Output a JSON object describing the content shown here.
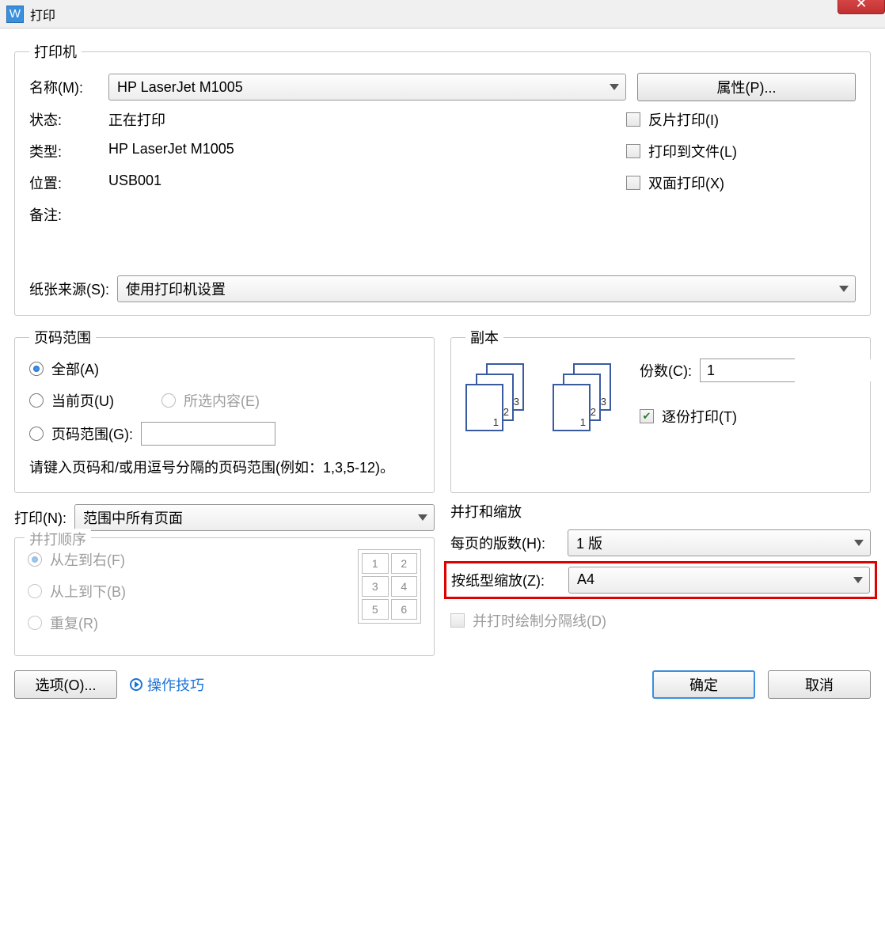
{
  "title": "打印",
  "printer": {
    "group_title": "打印机",
    "name_label": "名称(M):",
    "name_value": "HP LaserJet M1005",
    "properties_button": "属性(P)...",
    "status_label": "状态:",
    "status_value": "正在打印",
    "type_label": "类型:",
    "type_value": "HP LaserJet M1005",
    "location_label": "位置:",
    "location_value": "USB001",
    "remark_label": "备注:",
    "remark_value": "",
    "invert_label": "反片打印(I)",
    "to_file_label": "打印到文件(L)",
    "duplex_label": "双面打印(X)",
    "paper_source_label": "纸张来源(S):",
    "paper_source_value": "使用打印机设置"
  },
  "range": {
    "group_title": "页码范围",
    "all_label": "全部(A)",
    "current_label": "当前页(U)",
    "selection_label": "所选内容(E)",
    "range_label": "页码范围(G):",
    "hint": "请键入页码和/或用逗号分隔的页码范围(例如：1,3,5-12)。"
  },
  "copies": {
    "group_title": "副本",
    "count_label": "份数(C):",
    "count_value": "1",
    "collate_label": "逐份打印(T)",
    "sheet1": "1",
    "sheet2": "2",
    "sheet3": "3"
  },
  "print_what": {
    "label": "打印(N):",
    "value": "范围中所有页面"
  },
  "order": {
    "group_title": "并打顺序",
    "ltr_label": "从左到右(F)",
    "ttb_label": "从上到下(B)",
    "repeat_label": "重复(R)",
    "c1": "1",
    "c2": "2",
    "c3": "3",
    "c4": "4",
    "c5": "5",
    "c6": "6"
  },
  "layout": {
    "group_title": "并打和缩放",
    "per_page_label": "每页的版数(H):",
    "per_page_value": "1 版",
    "scale_label": "按纸型缩放(Z):",
    "scale_value": "A4",
    "divider_label": "并打时绘制分隔线(D)"
  },
  "footer": {
    "options_button": "选项(O)...",
    "tips_link": "操作技巧",
    "ok_button": "确定",
    "cancel_button": "取消"
  }
}
